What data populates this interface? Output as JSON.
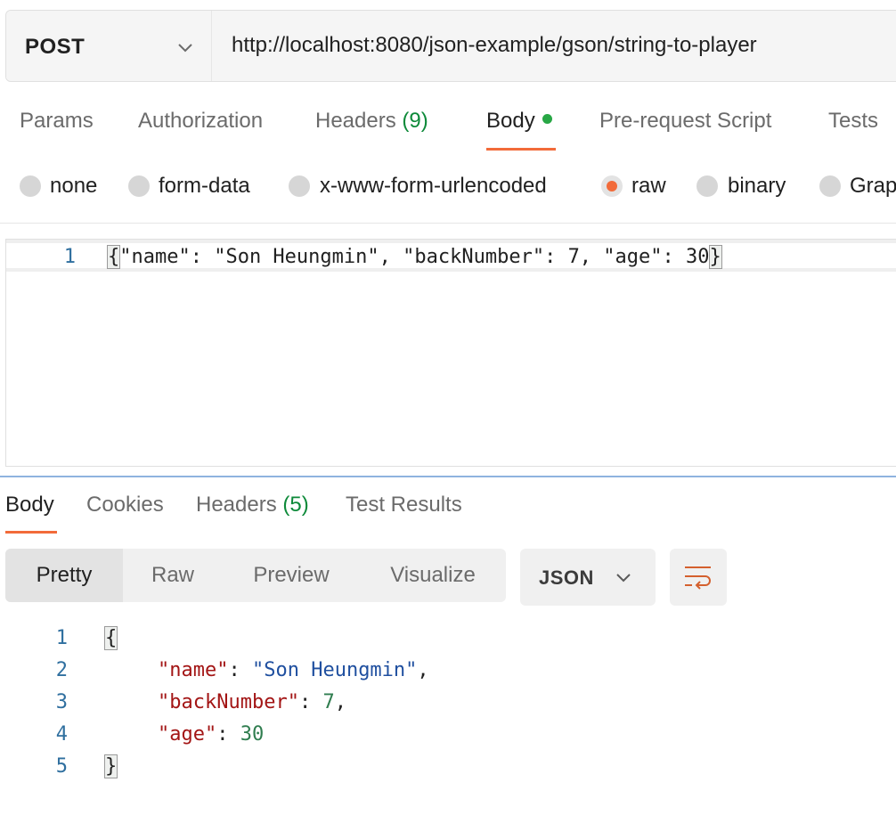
{
  "request": {
    "method": "POST",
    "url": "http://localhost:8080/json-example/gson/string-to-player"
  },
  "request_tabs": [
    {
      "label": "Params"
    },
    {
      "label": "Authorization"
    },
    {
      "label": "Headers",
      "count": "(9)"
    },
    {
      "label": "Body",
      "active": true
    },
    {
      "label": "Pre-request Script"
    },
    {
      "label": "Tests"
    }
  ],
  "body_types": [
    {
      "label": "none"
    },
    {
      "label": "form-data"
    },
    {
      "label": "x-www-form-urlencoded"
    },
    {
      "label": "raw",
      "selected": true
    },
    {
      "label": "binary"
    },
    {
      "label": "Grap"
    }
  ],
  "request_body": {
    "line_number": "1",
    "open_brace": "{",
    "content": "\"name\": \"Son Heungmin\", \"backNumber\": 7, \"age\": 30",
    "close_brace": "}"
  },
  "response_tabs": [
    {
      "label": "Body",
      "active": true
    },
    {
      "label": "Cookies"
    },
    {
      "label": "Headers",
      "count": "(5)"
    },
    {
      "label": "Test Results"
    }
  ],
  "view_modes": [
    {
      "label": "Pretty",
      "active": true
    },
    {
      "label": "Raw"
    },
    {
      "label": "Preview"
    },
    {
      "label": "Visualize"
    }
  ],
  "format_select": {
    "value": "JSON"
  },
  "response_body": {
    "line_numbers": [
      "1",
      "2",
      "3",
      "4",
      "5"
    ],
    "open_brace": "{",
    "close_brace": "}",
    "entries": [
      {
        "key": "\"name\"",
        "sep": ": ",
        "value": "\"Son Heungmin\"",
        "trail": ","
      },
      {
        "key": "\"backNumber\"",
        "sep": ": ",
        "value": "7",
        "trail": ","
      },
      {
        "key": "\"age\"",
        "sep": ": ",
        "value": "30",
        "trail": ""
      }
    ]
  },
  "colors": {
    "accent": "#f26b3a",
    "dot": "#28a745",
    "count": "#0e8a3a",
    "json_key": "#a31515",
    "json_string": "#1f4f9f",
    "json_number": "#2f7d4f"
  },
  "icons": {
    "method_dropdown": "chevron-down-icon",
    "format_dropdown": "chevron-down-icon",
    "wrap": "wrap-lines-icon"
  }
}
